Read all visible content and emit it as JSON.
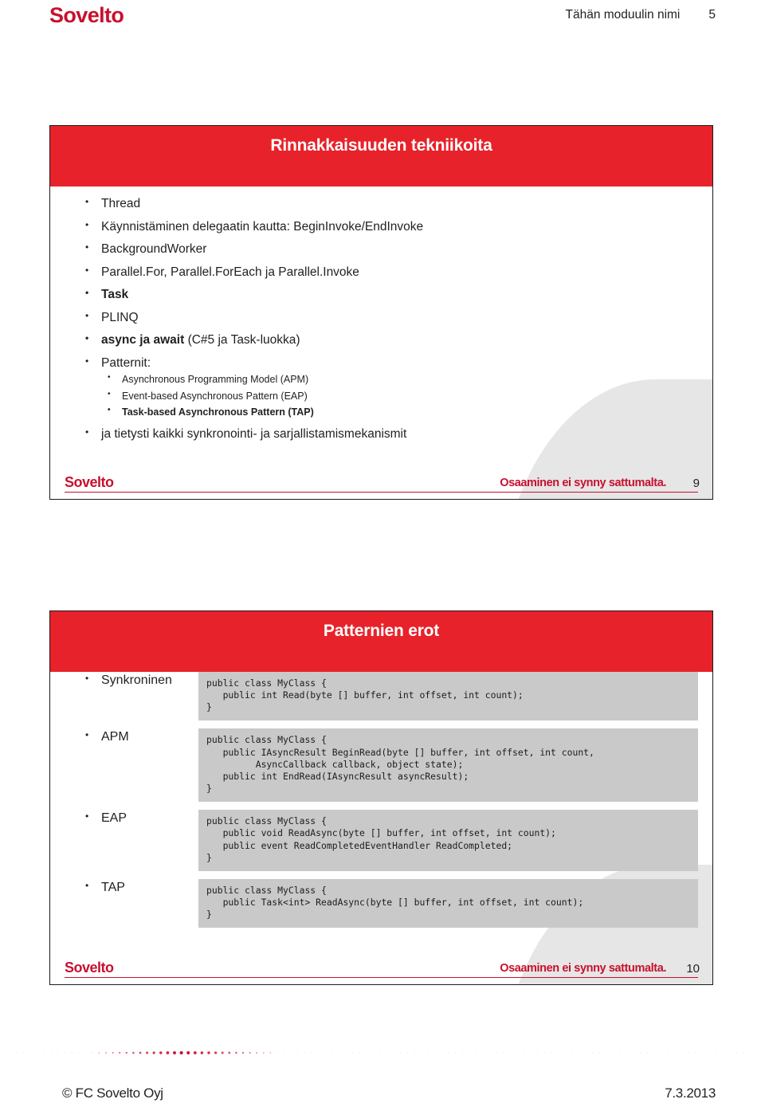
{
  "colors": {
    "brand_red": "#c8102e",
    "title_red": "#e8222a",
    "code_gray": "#c9c9c9",
    "text": "#231f20"
  },
  "header": {
    "logo": "Sovelto",
    "module_title": "Tähän moduulin nimi",
    "page_number": "5"
  },
  "slides": [
    {
      "title": "Rinnakkaisuuden tekniikoita",
      "bullets": [
        {
          "text": "Thread",
          "bold": false
        },
        {
          "text": "Käynnistäminen delegaatin kautta: BeginInvoke/EndInvoke",
          "bold": false
        },
        {
          "text": "BackgroundWorker",
          "bold": false
        },
        {
          "text": "Parallel.For, Parallel.ForEach ja Parallel.Invoke",
          "bold": false
        },
        {
          "text": "Task",
          "bold": true
        },
        {
          "text": "PLINQ",
          "bold": false
        },
        {
          "text": "async ja await",
          "bold": true,
          "suffix": " (C#5 ja Task-luokka)"
        },
        {
          "text": "Patternit:",
          "bold": false,
          "sub": [
            {
              "text": "Asynchronous Programming Model (APM)",
              "bold": false
            },
            {
              "text": "Event-based Asynchronous Pattern (EAP)",
              "bold": false
            },
            {
              "text": "Task-based Asynchronous Pattern (TAP)",
              "bold": true
            }
          ]
        },
        {
          "text": "ja tietysti kaikki synkronointi- ja sarjallistamismekanismit",
          "bold": false
        }
      ],
      "footer": {
        "brand": "Sovelto",
        "slogan": "Osaaminen ei synny sattumalta.",
        "number": "9"
      }
    },
    {
      "title": "Patternien erot",
      "rows": [
        {
          "label": "Synkroninen",
          "code": "public class MyClass {\n   public int Read(byte [] buffer, int offset, int count);\n}"
        },
        {
          "label": "APM",
          "code": "public class MyClass {\n   public IAsyncResult BeginRead(byte [] buffer, int offset, int count,\n         AsyncCallback callback, object state);\n   public int EndRead(IAsyncResult asyncResult);\n}"
        },
        {
          "label": "EAP",
          "code": "public class MyClass {\n   public void ReadAsync(byte [] buffer, int offset, int count);\n   public event ReadCompletedEventHandler ReadCompleted;\n}"
        },
        {
          "label": "TAP",
          "code": "public class MyClass {\n   public Task<int> ReadAsync(byte [] buffer, int offset, int count);\n}"
        }
      ],
      "footer": {
        "brand": "Sovelto",
        "slogan": "Osaaminen ei synny sattumalta.",
        "number": "10"
      }
    }
  ],
  "page_footer": {
    "copyright": "© FC Sovelto Oyj",
    "date": "7.3.2013"
  }
}
